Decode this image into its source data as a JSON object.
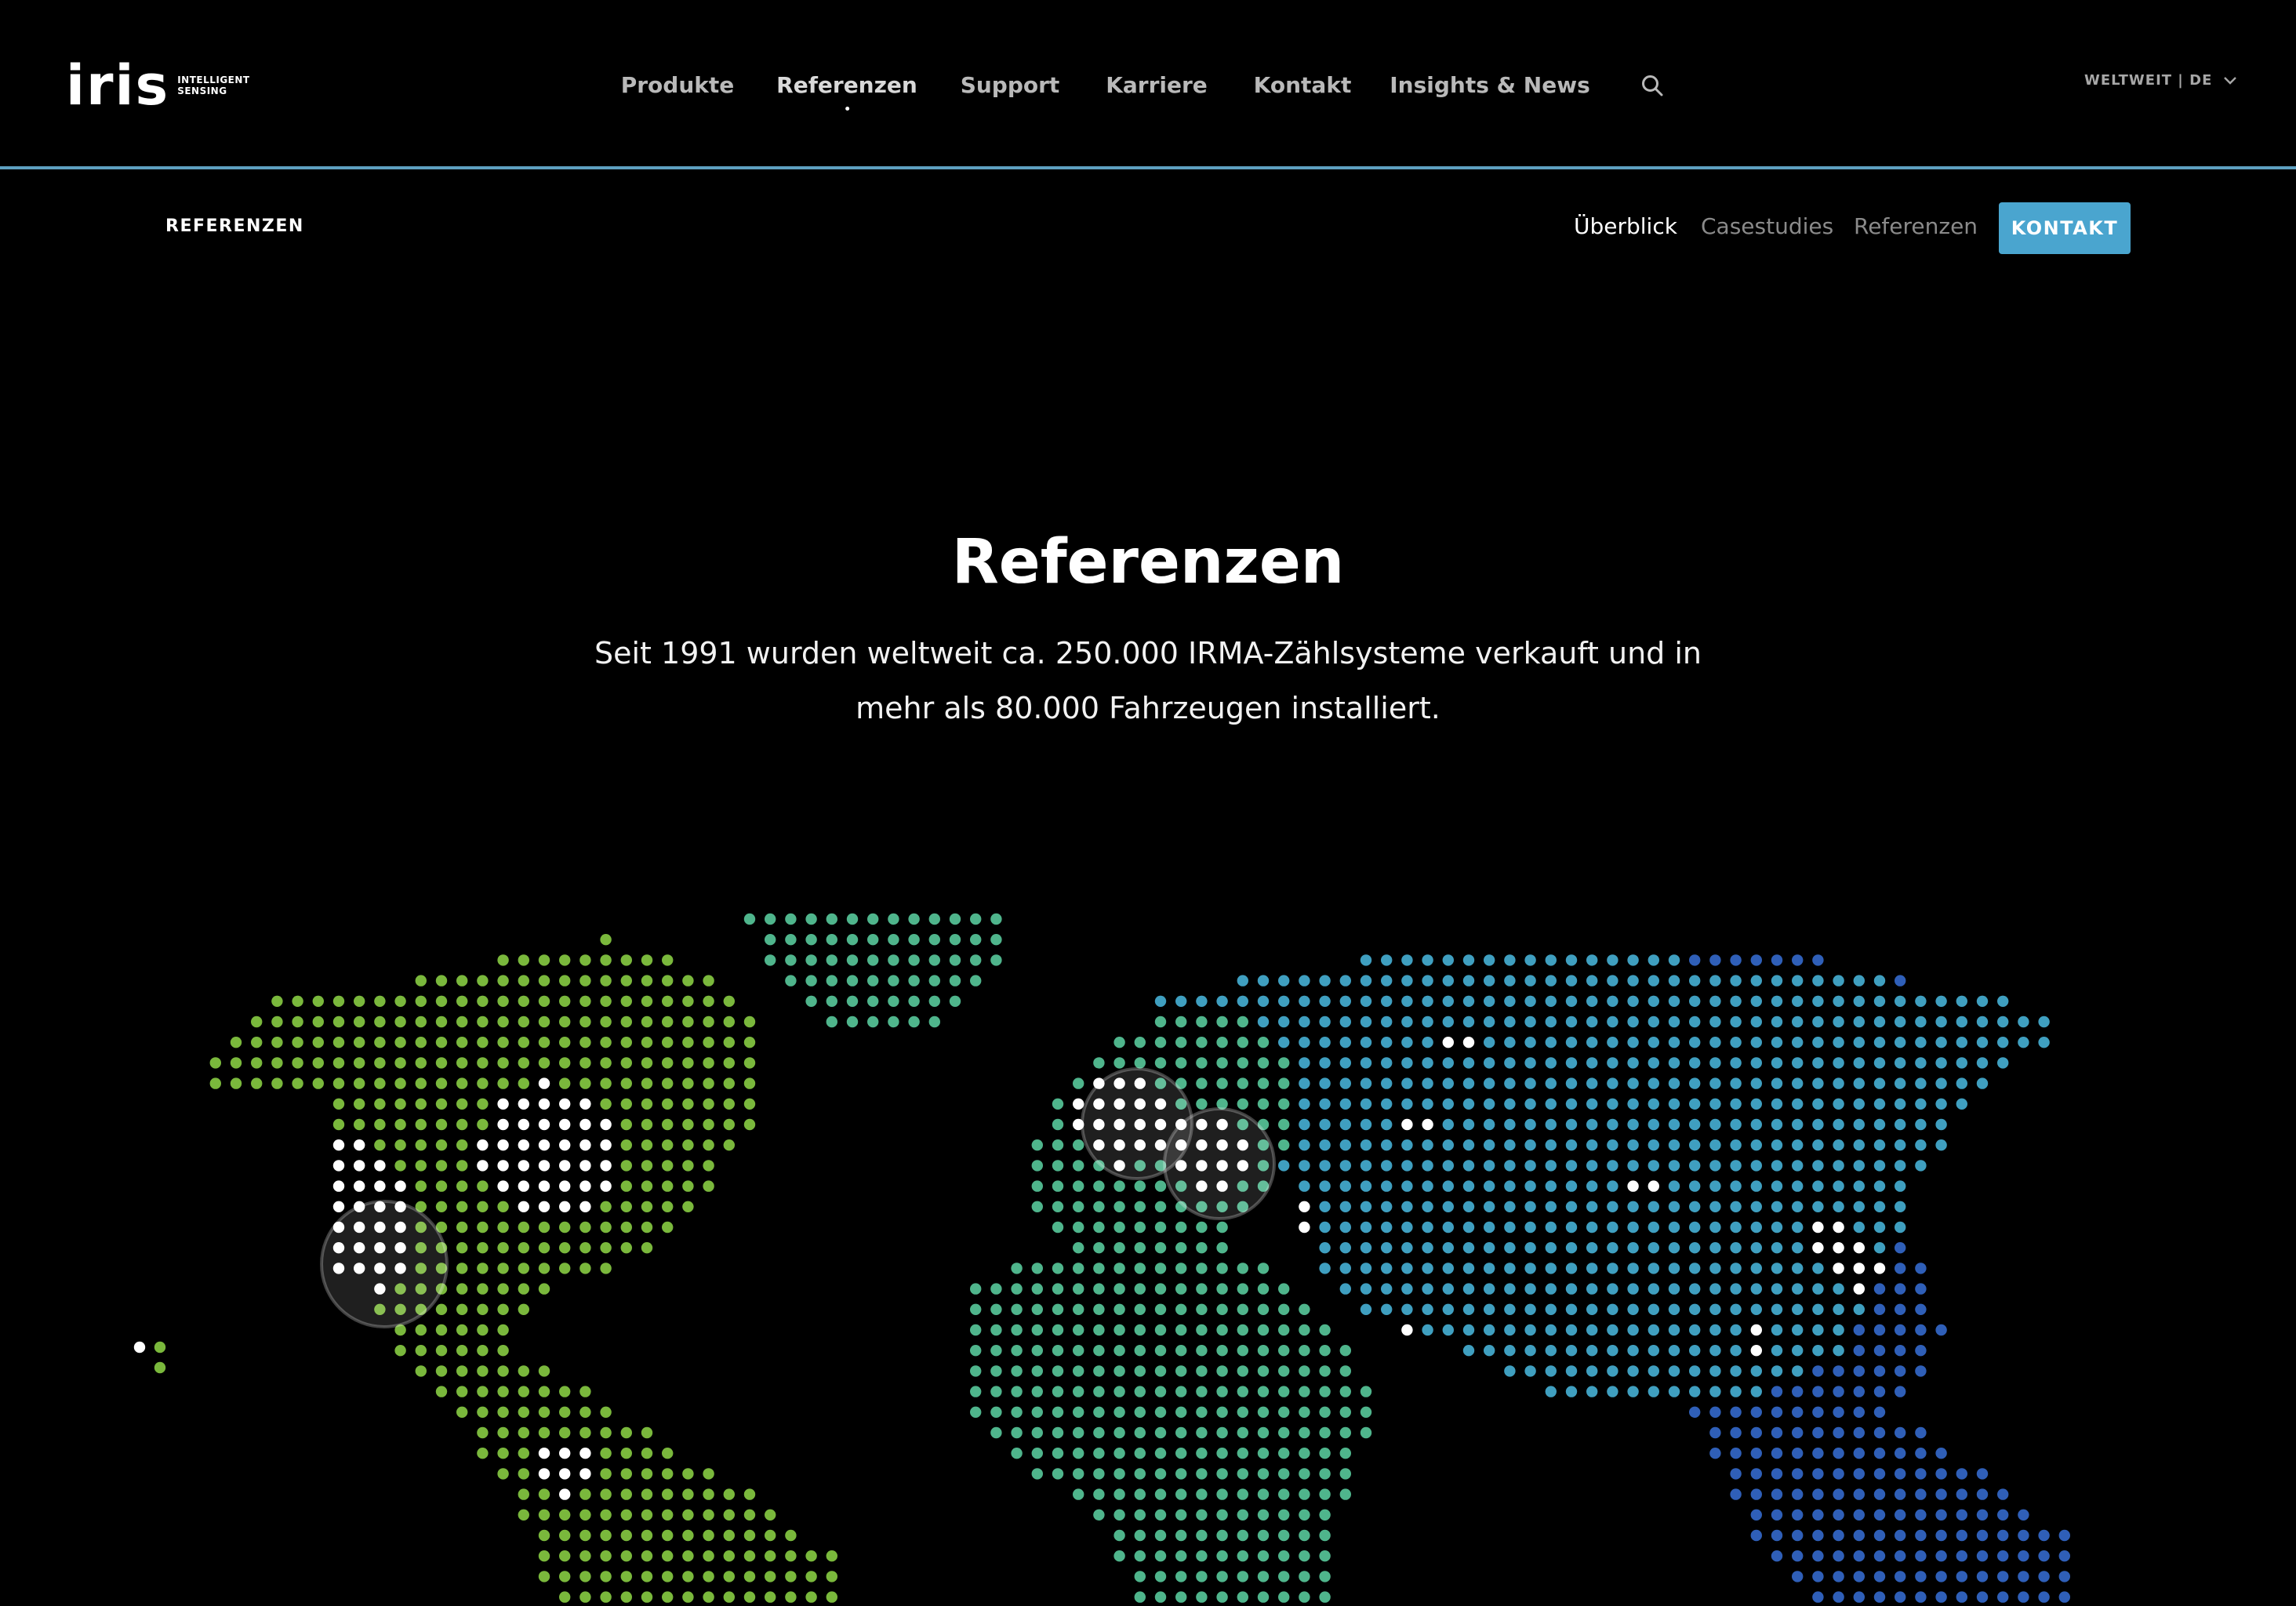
{
  "brand": {
    "logo_text": "iris",
    "tagline_line1": "INTELLIGENT",
    "tagline_line2": "SENSING"
  },
  "nav": {
    "items": [
      {
        "label": "Produkte"
      },
      {
        "label": "Referenzen",
        "active": true
      },
      {
        "label": "Support"
      },
      {
        "label": "Karriere"
      },
      {
        "label": "Kontakt"
      },
      {
        "label": "Insights & News"
      }
    ],
    "search_icon": "search-icon",
    "locale_label": "WELTWEIT | DE",
    "locale_icon": "chevron-down-icon"
  },
  "subnav": {
    "title": "REFERENZEN",
    "links": [
      {
        "label": "Überblick",
        "current": true
      },
      {
        "label": "Casestudies"
      },
      {
        "label": "Referenzen"
      }
    ],
    "cta_label": "KONTAKT"
  },
  "hero": {
    "title": "Referenzen",
    "text_line1": "Seit 1991 wurden weltweit ca. 250.000 IRMA-Zählsysteme verkauft und in",
    "text_line2": "mehr als 80.000 Fahrzeugen installiert."
  },
  "colors": {
    "background": "#000000",
    "accent": "#4aa5cf",
    "map_america": "#7ab83c",
    "map_europe_africa": "#4fb58c",
    "map_asia": "#3f9fc0",
    "map_east": "#2f5fb8",
    "map_highlight": "#ffffff"
  }
}
